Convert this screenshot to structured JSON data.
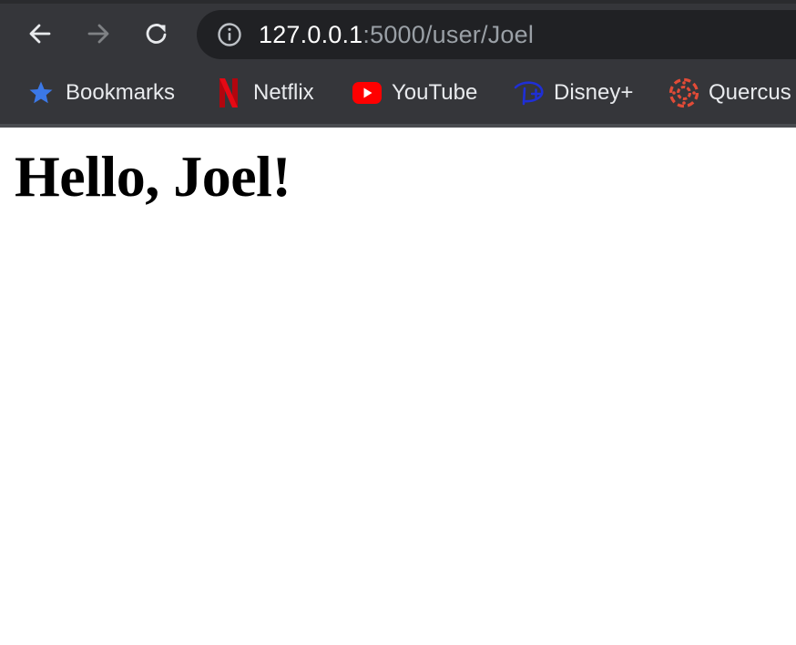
{
  "address_bar": {
    "url_host": "127.0.0.1",
    "url_path": ":5000/user/Joel"
  },
  "bookmarks": [
    {
      "label": "Bookmarks",
      "icon": "star-icon",
      "color": "#3b78e7"
    },
    {
      "label": "Netflix",
      "icon": "netflix-icon",
      "color": "#e50914"
    },
    {
      "label": "YouTube",
      "icon": "youtube-icon",
      "color": "#ff0000"
    },
    {
      "label": "Disney+",
      "icon": "disney-plus-icon",
      "color": "#1f2fd6"
    },
    {
      "label": "Quercus",
      "icon": "canvas-icon",
      "color": "#e24b37"
    }
  ],
  "page": {
    "heading": "Hello, Joel!"
  },
  "colors": {
    "chrome_background": "#35363a",
    "address_bar_background": "#202124",
    "url_host_color": "#ffffff",
    "url_path_color": "#9aa0a6",
    "page_background": "#ffffff"
  }
}
